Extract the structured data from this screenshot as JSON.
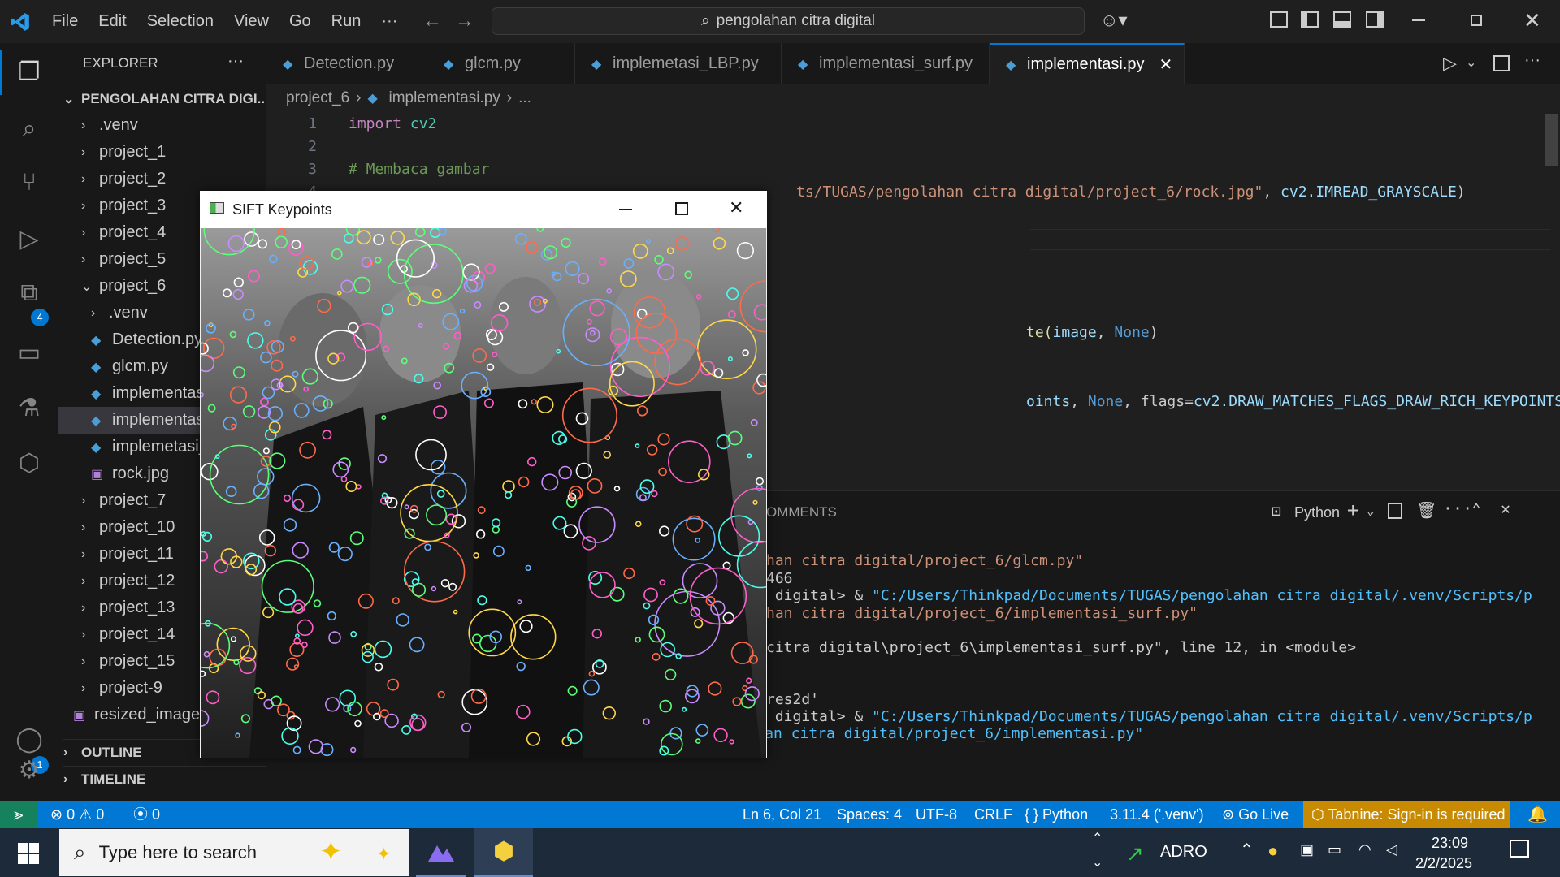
{
  "titlebar": {
    "menu": [
      "File",
      "Edit",
      "Selection",
      "View",
      "Go",
      "Run",
      "···"
    ],
    "search_text": "pengolahan citra digital"
  },
  "activity": {
    "extensions_badge": "4",
    "accounts_badge": "1"
  },
  "sidebar": {
    "header": "EXPLORER",
    "header_more": "···",
    "root": "PENGOLAHAN CITRA DIGI...",
    "items": [
      ".venv",
      "project_1",
      "project_2",
      "project_3",
      "project_4",
      "project_5",
      "project_6",
      ".venv",
      "Detection.py",
      "glcm.py",
      "implementas",
      "implementas",
      "implemetasi_",
      "rock.jpg",
      "project_7",
      "project_10",
      "project_11",
      "project_12",
      "project_13",
      "project_14",
      "project_15",
      "project-9",
      "resized_image"
    ],
    "outline": "OUTLINE",
    "timeline": "TIMELINE"
  },
  "tabs": [
    "Detection.py",
    "glcm.py",
    "implemetasi_LBP.py",
    "implementasi_surf.py",
    "implementasi.py"
  ],
  "breadcrumb": {
    "folder": "project_6",
    "file": "implementasi.py",
    "more": "..."
  },
  "editor": {
    "line_numbers": [
      "1",
      "2",
      "3",
      "4"
    ],
    "line1_kw": "import",
    "line1_mod": " cv2",
    "line3_comment": "# Membaca gambar",
    "line4_path": "ts/TUGAS/pengolahan citra digital/project_6/rock.jpg\"",
    "line4_rest": ", ",
    "line4_const": "cv2.IMREAD_GRAYSCALE",
    "line4_end": ")",
    "line7_a": "te(",
    "line7_b": "image",
    "line7_c": ", ",
    "line7_d": "None",
    "line7_e": ")",
    "line10_a": "oints",
    "line10_b": ", ",
    "line10_c": "None",
    "line10_d": ", flags=",
    "line10_e": "cv2.DRAW_MATCHES_FLAGS_DRAW_RICH_KEYPOINTS",
    "line10_f": ")"
  },
  "panel": {
    "tab_partial": "OMMENTS",
    "shell": "Python",
    "lines": [
      "han citra digital/project_6/glcm.py\"",
      "466",
      " digital> & ",
      "\"C:/Users/Thinkpad/Documents/TUGAS/pengolahan citra digital/.venv/Scripts/p",
      "han citra digital/project_6/implementasi_surf.py\"",
      "citra digital\\project_6\\implementasi_surf.py\", line 12, in <module>",
      "res2d'",
      " digital> & ",
      "\"C:/Users/Thinkpad/Documents/TUGAS/pengolahan citra digital/.venv/Scripts/p",
      "ython.exe\" \"c:/Users/Thinkpad/Documents/TUGAS/pengolahan citra digital/project_6/implementasi.py\""
    ]
  },
  "status": {
    "errors": "0",
    "warnings": "0",
    "ports": "0",
    "position": "Ln 6, Col 21",
    "spaces": "Spaces: 4",
    "encoding": "UTF-8",
    "eol": "CRLF",
    "language": "Python",
    "interpreter": "3.11.4 ('.venv')",
    "golive": "Go Live",
    "tabnine": "Tabnine: Sign-in is required"
  },
  "sift_window": {
    "title": "SIFT Keypoints"
  },
  "taskbar": {
    "search_placeholder": "Type here to search",
    "stock": "ADRO",
    "time": "23:09",
    "date": "2/2/2025"
  },
  "colors": {
    "accent": "#0078d4",
    "background": "#1f1f1f"
  }
}
